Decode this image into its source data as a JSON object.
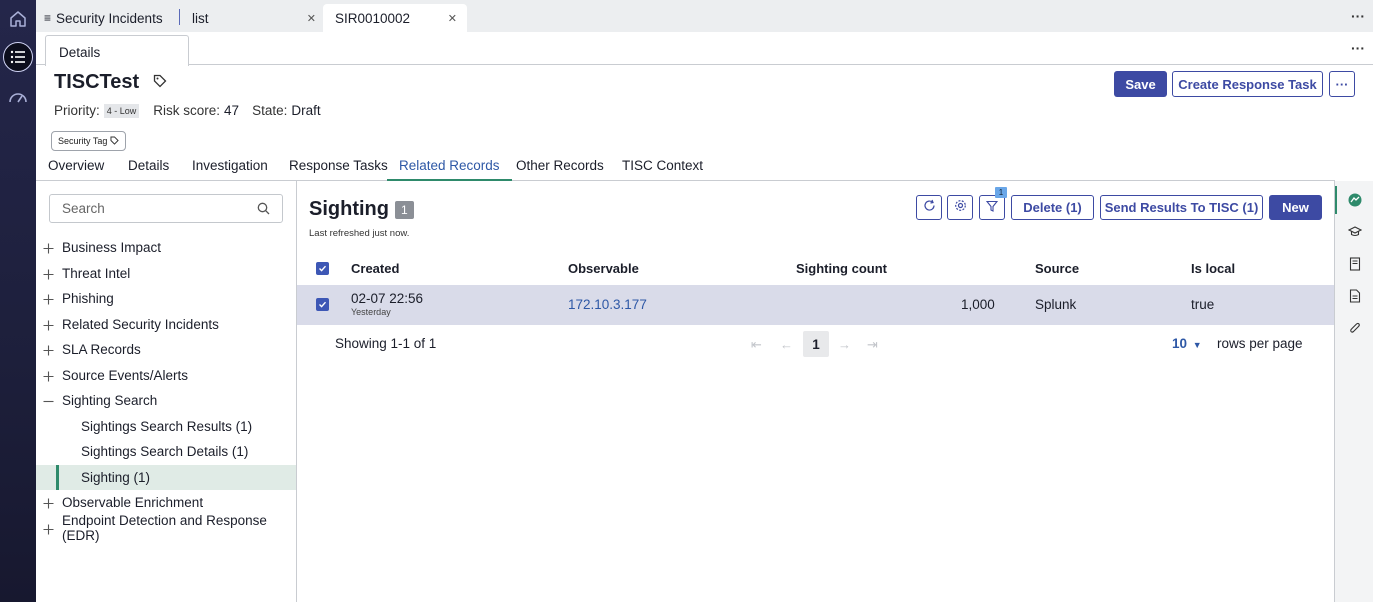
{
  "tabs": {
    "app_title": "Security Incidents",
    "list_tab": "list",
    "record_tab": "SIR0010002"
  },
  "subtab": {
    "details": "Details"
  },
  "record": {
    "title": "TISCTest",
    "priority_label": "Priority:",
    "priority_value": "4 - Low",
    "risk_label": "Risk score:",
    "risk_value": "47",
    "state_label": "State:",
    "state_value": "Draft",
    "security_tag": "Security Tag"
  },
  "header_actions": {
    "save": "Save",
    "create_response_task": "Create Response Task"
  },
  "section_tabs": [
    "Overview",
    "Details",
    "Investigation",
    "Response Tasks",
    "Related Records",
    "Other Records",
    "TISC Context"
  ],
  "tree": {
    "search_placeholder": "Search",
    "items": [
      {
        "label": "Business Impact",
        "expanded": false
      },
      {
        "label": "Threat Intel",
        "expanded": false
      },
      {
        "label": "Phishing",
        "expanded": false
      },
      {
        "label": "Related Security Incidents",
        "expanded": false
      },
      {
        "label": "SLA Records",
        "expanded": false
      },
      {
        "label": "Source Events/Alerts",
        "expanded": false
      },
      {
        "label": "Sighting Search",
        "expanded": true
      },
      {
        "label": "Sightings Search Results (1)",
        "child": true
      },
      {
        "label": "Sightings Search Details (1)",
        "child": true
      },
      {
        "label": "Sighting (1)",
        "child": true,
        "selected": true
      },
      {
        "label": "Observable Enrichment",
        "expanded": false
      },
      {
        "label": "Endpoint Detection and Response (EDR)",
        "expanded": false
      }
    ]
  },
  "list": {
    "title": "Sighting",
    "count": "1",
    "refreshed": "Last refreshed just now.",
    "filter_count": "1",
    "delete_label": "Delete (1)",
    "send_label": "Send Results To TISC (1)",
    "new_label": "New",
    "columns": [
      "Created",
      "Observable",
      "Sighting count",
      "Source",
      "Is local"
    ],
    "rows": [
      {
        "created": "02-07 22:56",
        "created_sub": "Yesterday",
        "observable": "172.10.3.177",
        "sighting_count": "1,000",
        "source": "Splunk",
        "is_local": "true"
      }
    ],
    "showing": "Showing 1-1 of 1",
    "current_page": "1",
    "rows_per_page_value": "10",
    "rows_per_page_label": "rows per page"
  },
  "colors": {
    "primary": "#3d4aa3",
    "accent_green": "#2e8a6b",
    "row_selected": "#d9dbe9"
  }
}
